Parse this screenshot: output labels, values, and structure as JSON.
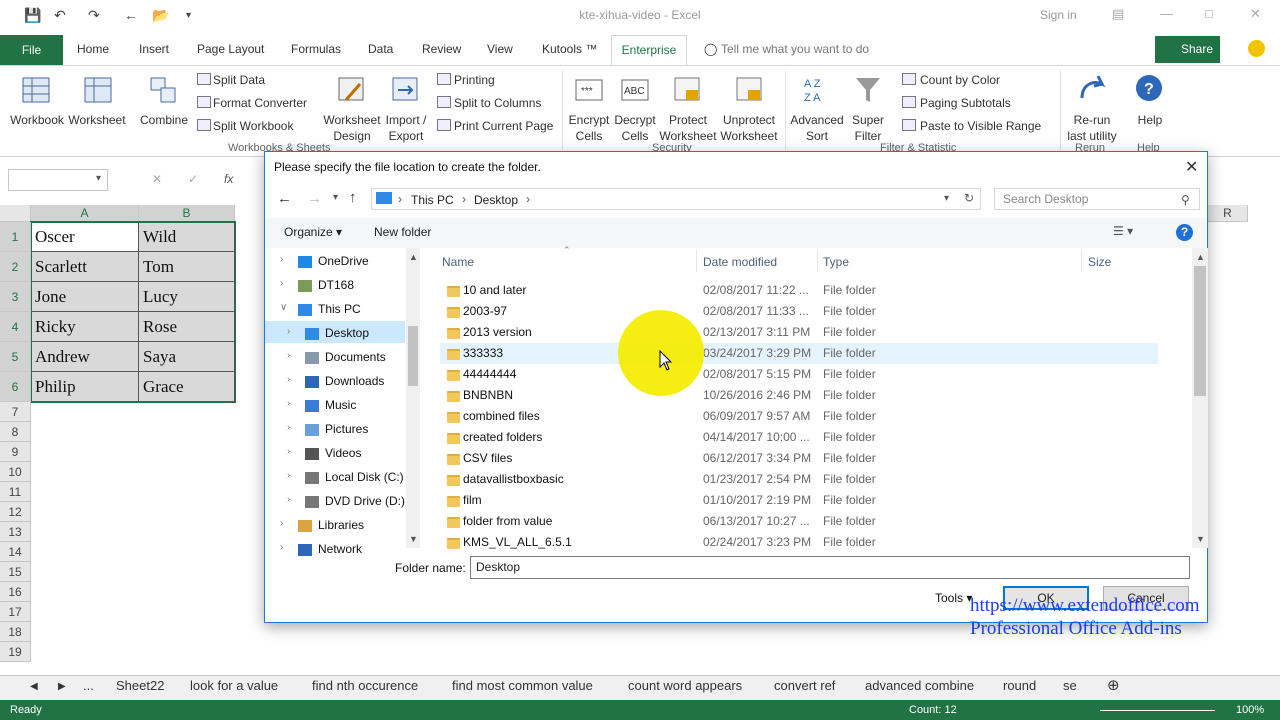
{
  "window": {
    "title": "kte-xihua-video - Excel",
    "signin": "Sign in"
  },
  "tabs": {
    "file": "File",
    "items": [
      "Home",
      "Insert",
      "Page Layout",
      "Formulas",
      "Data",
      "Review",
      "View",
      "Kutools ™"
    ],
    "active": "Enterprise",
    "tell_me": "Tell me what you want to do",
    "share": "Share"
  },
  "ribbon": {
    "workbook": "Workbook",
    "worksheet": "Worksheet",
    "combine": "Combine",
    "split_data": "Split Data",
    "format_converter": "Format Converter",
    "split_workbook": "Split Workbook",
    "worksheet_design": [
      "Worksheet",
      "Design"
    ],
    "import_export": [
      "Import /",
      "Export"
    ],
    "printing": "Printing",
    "split_to_columns": "Split to Columns",
    "print_current_page": "Print Current Page",
    "encrypt_cells": [
      "Encrypt",
      "Cells"
    ],
    "decrypt_cells": [
      "Decrypt",
      "Cells"
    ],
    "protect_worksheet": [
      "Protect",
      "Worksheet"
    ],
    "unprotect_worksheet": [
      "Unprotect",
      "Worksheet"
    ],
    "advanced_sort": [
      "Advanced",
      "Sort"
    ],
    "super_filter": [
      "Super",
      "Filter"
    ],
    "count_by_color": "Count by Color",
    "paging_subtotals": "Paging Subtotals",
    "paste_to_visible_range": "Paste to Visible Range",
    "rerun": [
      "Re-run",
      "last utility"
    ],
    "help": "Help",
    "groups": {
      "workbooks_sheets": "Workbooks & Sheets",
      "security": "Security",
      "filter_statistic": "Filter & Statistic",
      "rerun": "Rerun",
      "help": "Help"
    }
  },
  "sheet": {
    "columns": [
      "A",
      "B"
    ],
    "last_col": "R",
    "rows": [
      "1",
      "2",
      "3",
      "4",
      "5",
      "6",
      "7",
      "8",
      "9",
      "10",
      "11",
      "12",
      "13",
      "14",
      "15",
      "16",
      "17",
      "18",
      "19"
    ],
    "data": [
      [
        "Oscer",
        "Wild"
      ],
      [
        "Scarlett",
        "Tom"
      ],
      [
        "Jone",
        "Lucy"
      ],
      [
        "Ricky",
        "Rose"
      ],
      [
        "Andrew",
        "Saya"
      ],
      [
        "Philip",
        "Grace"
      ]
    ]
  },
  "sheet_tabs": [
    "...",
    "Sheet22",
    "look for a value",
    "find nth occurence",
    "find most common value",
    "count word appears",
    "convert ref",
    "advanced combine",
    "round",
    "se"
  ],
  "status": {
    "ready": "Ready",
    "count": "Count: 12",
    "zoom": "100%"
  },
  "dialog": {
    "title": "Please specify the file location to create the folder.",
    "breadcrumb": [
      "This PC",
      "Desktop"
    ],
    "search_placeholder": "Search Desktop",
    "organize": "Organize",
    "new_folder": "New folder",
    "nav": [
      "OneDrive",
      "DT168",
      "This PC",
      "Desktop",
      "Documents",
      "Downloads",
      "Music",
      "Pictures",
      "Videos",
      "Local Disk (C:)",
      "DVD Drive (D:)",
      "Libraries",
      "Network"
    ],
    "columns": {
      "name": "Name",
      "date": "Date modified",
      "type": "Type",
      "size": "Size"
    },
    "files": [
      {
        "name": "10 and later",
        "date": "02/08/2017 11:22 ...",
        "type": "File folder"
      },
      {
        "name": "2003-97",
        "date": "02/08/2017 11:33 ...",
        "type": "File folder"
      },
      {
        "name": "2013 version",
        "date": "02/13/2017 3:11 PM",
        "type": "File folder"
      },
      {
        "name": "333333",
        "date": "03/24/2017 3:29 PM",
        "type": "File folder"
      },
      {
        "name": "44444444",
        "date": "02/08/2017 5:15 PM",
        "type": "File folder"
      },
      {
        "name": "BNBNBN",
        "date": "10/26/2016 2:46 PM",
        "type": "File folder"
      },
      {
        "name": "combined files",
        "date": "06/09/2017 9:57 AM",
        "type": "File folder"
      },
      {
        "name": "created folders",
        "date": "04/14/2017 10:00 ...",
        "type": "File folder"
      },
      {
        "name": "CSV files",
        "date": "06/12/2017 3:34 PM",
        "type": "File folder"
      },
      {
        "name": "datavallistboxbasic",
        "date": "01/23/2017 2:54 PM",
        "type": "File folder"
      },
      {
        "name": "film",
        "date": "01/10/2017 2:19 PM",
        "type": "File folder"
      },
      {
        "name": "folder from value",
        "date": "06/13/2017 10:27 ...",
        "type": "File folder"
      },
      {
        "name": "KMS_VL_ALL_6.5.1",
        "date": "02/24/2017 3:23 PM",
        "type": "File folder"
      }
    ],
    "folder_name_label": "Folder name:",
    "folder_name_value": "Desktop",
    "tools": "Tools",
    "ok": "OK",
    "cancel": "Cancel"
  },
  "watermark": [
    "https://www.extendoffice.com",
    "Professional Office Add-ins"
  ]
}
